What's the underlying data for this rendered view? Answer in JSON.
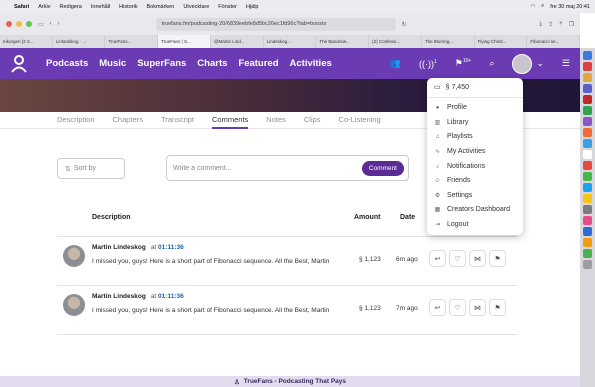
{
  "os_menubar": {
    "apple": "",
    "items": [
      "Safari",
      "Arkiv",
      "Redigera",
      "Innehåll",
      "Historik",
      "Bokmärken",
      "Utvecklare",
      "Fönster",
      "Hjälp"
    ],
    "clock": "fre 30 maj 20:41"
  },
  "browser": {
    "url": "truefans.fm/podcasting-20/6839eebfe8d5bc26ec1fd96c?tab=boosts",
    "tabs": [
      "Inkorgen (2 3...",
      "Linkedskog · ...",
      "TrueFans...",
      "TrueFans | S...",
      "@Martin Lind...",
      "Lindeskog...",
      "The Bandrew...",
      "(2) Confessi...",
      "The Blurring...",
      "Flying Christ...",
      "Fibonacci se..."
    ]
  },
  "nav": {
    "links": [
      "Podcasts",
      "Music",
      "SuperFans",
      "Charts",
      "Featured",
      "Activities"
    ],
    "notif_count": "1",
    "boost_count": "10+"
  },
  "subtabs": [
    "Description",
    "Chapters",
    "Transcript",
    "Comments",
    "Notes",
    "Clips",
    "Co-Listening"
  ],
  "active_subtab": "Comments",
  "sort": {
    "label": "Sort by"
  },
  "comment_input": {
    "placeholder": "Write a comment...",
    "button": "Comment"
  },
  "table": {
    "headers": {
      "description": "Description",
      "amount": "Amount",
      "date": "Date"
    },
    "rows": [
      {
        "author": "Martin Lindeskog",
        "at": "at",
        "timestamp": "01:11:36",
        "text": "I missed you, guys! Here is a short part of Fibonacci sequence. All the Best, Martin",
        "amount": "§ 1,123",
        "date": "6m ago"
      },
      {
        "author": "Martin Lindeskog",
        "at": "at",
        "timestamp": "01:11:36",
        "text": "I missed you, guys! Here is a short part of Fibonacci sequence. All the Best, Martin",
        "amount": "§ 1,123",
        "date": "7m ago"
      }
    ]
  },
  "menu": {
    "balance": "§ 7,450",
    "items": [
      "Profile",
      "Library",
      "Playlists",
      "My Activities",
      "Notifications",
      "Friends",
      "Settings",
      "Creators Dashboard",
      "Logout"
    ]
  },
  "footer": {
    "text": "TrueFans - Podcasting That Pays"
  },
  "colors": {
    "brand": "#6a3bb3",
    "button": "#5b2c96",
    "link": "#1b5fb3"
  }
}
